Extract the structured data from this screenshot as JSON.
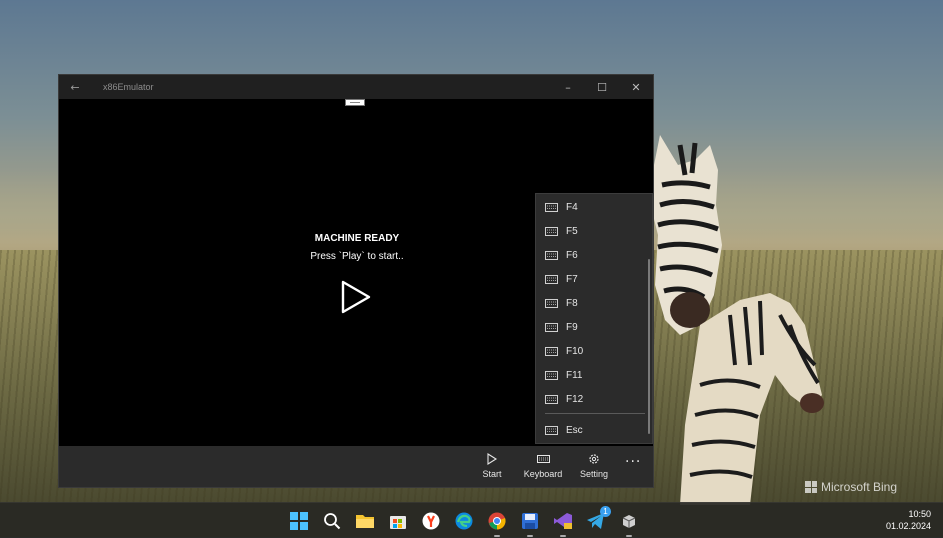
{
  "window": {
    "title": "x86Emulator",
    "back_icon": "back-arrow-icon",
    "minimize": "–",
    "maximize": "☐",
    "close": "✕"
  },
  "screen": {
    "status_title": "MACHINE READY",
    "status_subtitle": "Press `Play` to start..",
    "play_icon": "play-icon"
  },
  "keyboard_menu": {
    "items": [
      "F4",
      "F5",
      "F6",
      "F7",
      "F8",
      "F9",
      "F10",
      "F11",
      "F12",
      "Esc"
    ]
  },
  "command_bar": {
    "start_label": "Start",
    "keyboard_label": "Keyboard",
    "setting_label": "Setting",
    "more_label": "···"
  },
  "wallpaper": {
    "watermark": "Microsoft Bing"
  },
  "taskbar": {
    "apps": [
      "start-icon",
      "search-icon",
      "file-explorer-icon",
      "microsoft-store-icon",
      "yandex-browser-icon",
      "edge-icon",
      "chrome-icon",
      "save-app-icon",
      "visual-studio-icon",
      "telegram-icon",
      "emulator-app-icon"
    ],
    "telegram_badge": "1",
    "time": "10:50",
    "date": "01.02.2024"
  },
  "colors": {
    "window_bg": "#000000",
    "titlebar_bg": "#202020",
    "panel_bg": "#2b2b2b",
    "text": "#e6e6e6"
  }
}
